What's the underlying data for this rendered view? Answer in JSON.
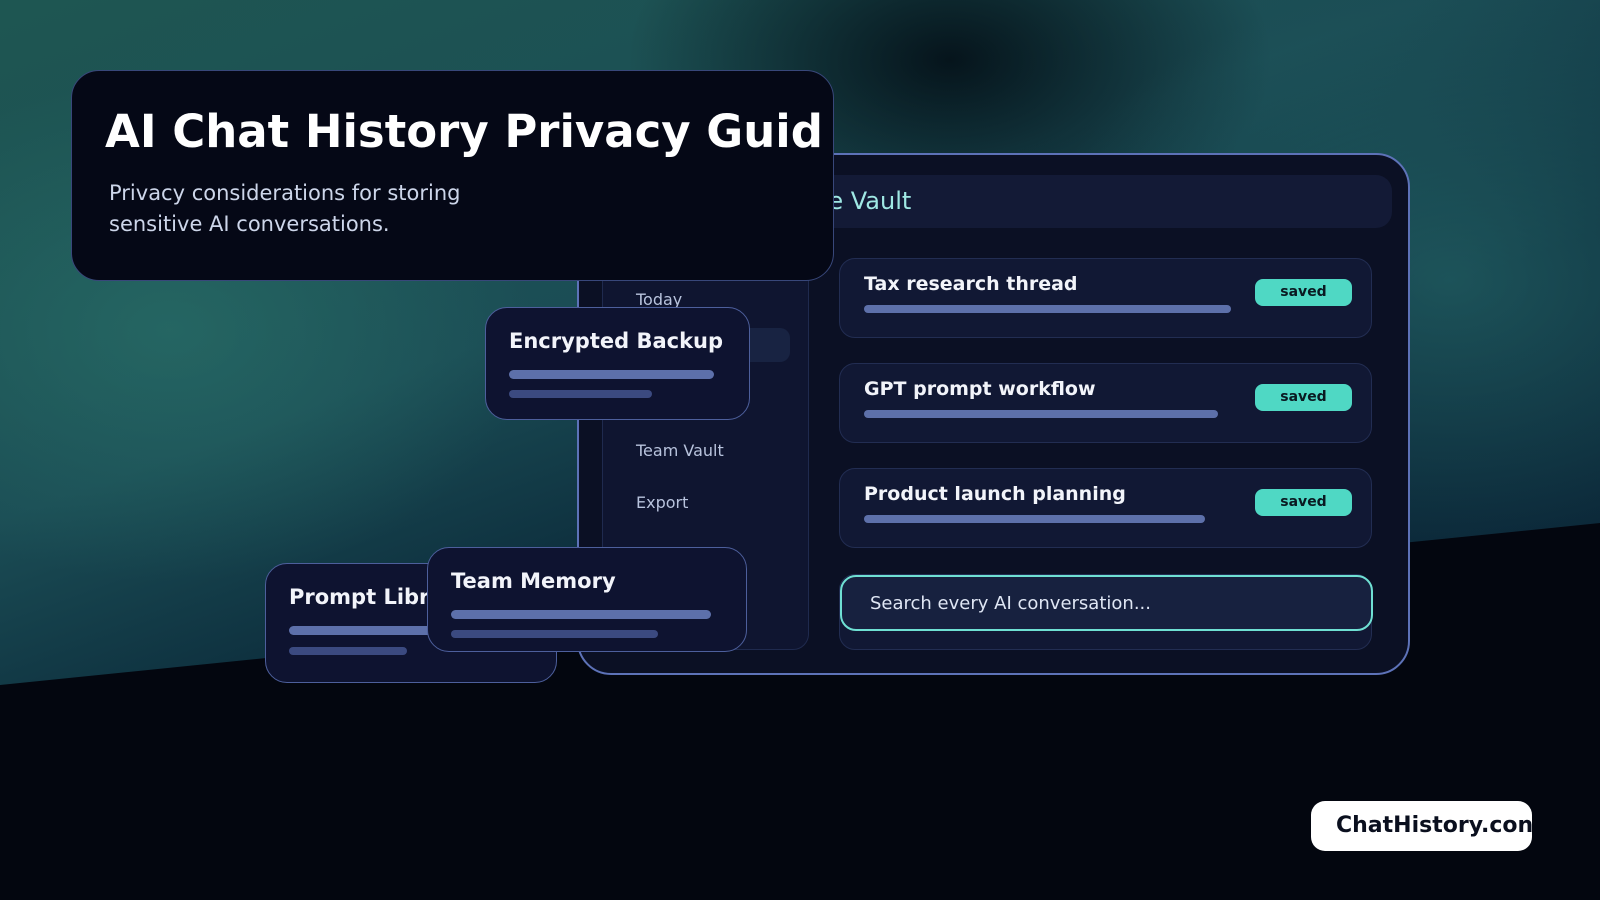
{
  "hero": {
    "title": "AI Chat History Privacy Guid",
    "subtitle": "Privacy considerations for storing sensitive AI conversations."
  },
  "window": {
    "title": "re Vault",
    "sidebar": {
      "items": [
        {
          "label": "Today"
        },
        {
          "label": "Team Vault"
        },
        {
          "label": "Export"
        }
      ]
    },
    "conversations": [
      {
        "title": "Tax research thread",
        "status": "saved"
      },
      {
        "title": "GPT prompt workflow",
        "status": "saved"
      },
      {
        "title": "Product launch planning",
        "status": "saved"
      }
    ],
    "search": {
      "placeholder": "Search every AI conversation..."
    }
  },
  "cards": {
    "backup": {
      "title": "Encrypted Backup"
    },
    "prompt": {
      "title": "Prompt Libr"
    },
    "team": {
      "title": "Team Memory"
    }
  },
  "brand": {
    "label": "ChatHistory.con"
  },
  "colors": {
    "accent": "#4fd8c4",
    "window_border": "#5d72b8",
    "background_dark": "#03060f"
  }
}
